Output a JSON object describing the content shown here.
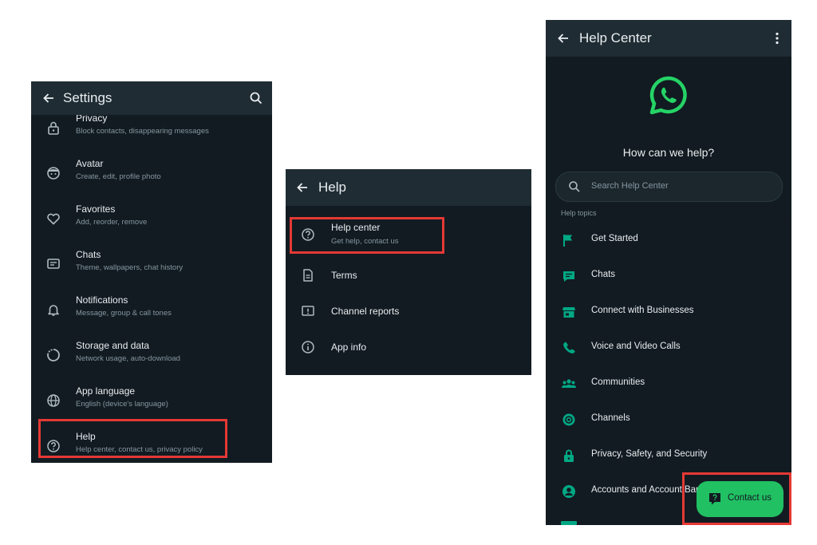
{
  "settings": {
    "title": "Settings",
    "items": [
      {
        "title": "Privacy",
        "subtitle": "Block contacts, disappearing messages"
      },
      {
        "title": "Avatar",
        "subtitle": "Create, edit, profile photo"
      },
      {
        "title": "Favorites",
        "subtitle": "Add, reorder, remove"
      },
      {
        "title": "Chats",
        "subtitle": "Theme, wallpapers, chat history"
      },
      {
        "title": "Notifications",
        "subtitle": "Message, group & call tones"
      },
      {
        "title": "Storage and data",
        "subtitle": "Network usage, auto-download"
      },
      {
        "title": "App language",
        "subtitle": "English (device's language)"
      },
      {
        "title": "Help",
        "subtitle": "Help center, contact us, privacy policy"
      }
    ]
  },
  "help": {
    "title": "Help",
    "items": [
      {
        "title": "Help center",
        "subtitle": "Get help, contact us"
      },
      {
        "title": "Terms"
      },
      {
        "title": "Channel reports"
      },
      {
        "title": "App info"
      }
    ]
  },
  "help_center": {
    "title": "Help Center",
    "heading": "How can we help?",
    "search_placeholder": "Search Help Center",
    "section_label": "Help topics",
    "topics": [
      "Get Started",
      "Chats",
      "Connect with Businesses",
      "Voice and Video Calls",
      "Communities",
      "Channels",
      "Privacy, Safety, and Security",
      "Accounts and Account Bans"
    ],
    "contact_button": "Contact us"
  },
  "colors": {
    "accent": "#25d366",
    "topic_icon": "#00a884",
    "highlight": "#e53935",
    "panel_bg": "#121b22",
    "appbar_bg": "#1f2c34"
  }
}
